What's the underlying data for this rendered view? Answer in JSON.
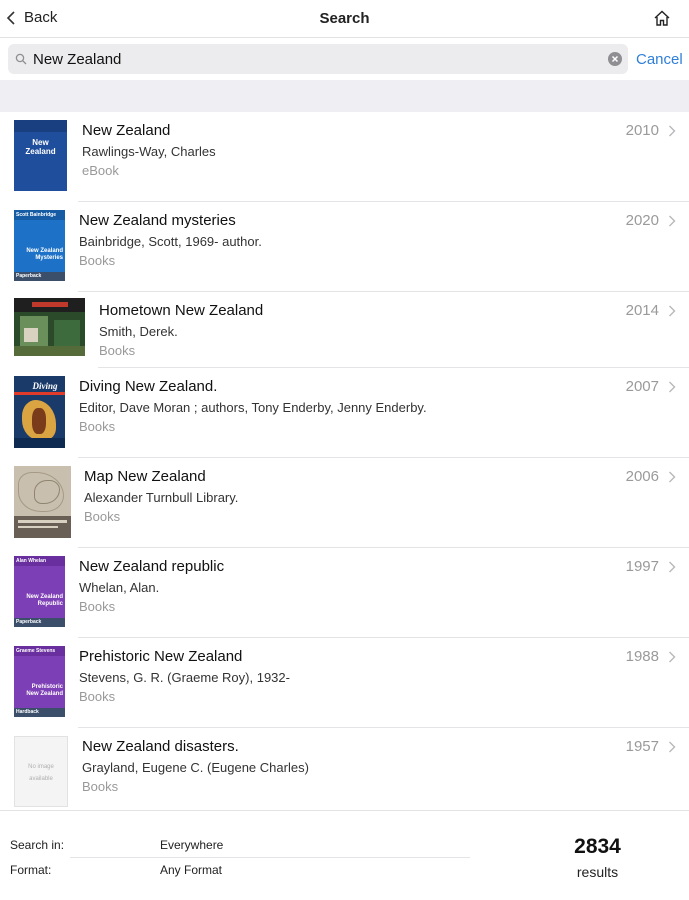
{
  "nav": {
    "back_label": "Back",
    "title": "Search"
  },
  "search": {
    "query": "New Zealand",
    "cancel_label": "Cancel"
  },
  "results": [
    {
      "title": "New Zealand",
      "author": "Rawlings-Way, Charles",
      "format": "eBook",
      "year": "2010",
      "cover_text": "New\nZealand",
      "cover_color": "#1f4e9c"
    },
    {
      "title": "New Zealand mysteries",
      "author": "Bainbridge, Scott, 1969- author.",
      "format": "Books",
      "year": "2020",
      "cover_top": "Scott Bainbridge",
      "cover_text": "New Zealand\nMysteries",
      "cover_bottom": "Paperback",
      "cover_color": "#1d72c8"
    },
    {
      "title": "Hometown New Zealand",
      "author": "Smith, Derek.",
      "format": "Books",
      "year": "2014",
      "cover_color": "#2a4a2a"
    },
    {
      "title": "Diving New Zealand.",
      "author": "Editor, Dave Moran ; authors, Tony Enderby, Jenny Enderby.",
      "format": "Books",
      "year": "2007",
      "cover_text": "Diving",
      "cover_color": "#1a3a6a"
    },
    {
      "title": "Map New Zealand",
      "author": "Alexander Turnbull Library.",
      "format": "Books",
      "year": "2006",
      "cover_color": "#c9bfae"
    },
    {
      "title": "New Zealand republic",
      "author": "Whelan, Alan.",
      "format": "Books",
      "year": "1997",
      "cover_top": "Alan Whelan",
      "cover_text": "New Zealand\nRepublic",
      "cover_bottom": "Paperback",
      "cover_color": "#7d3fb5"
    },
    {
      "title": "Prehistoric New Zealand",
      "author": "Stevens, G. R. (Graeme Roy), 1932-",
      "format": "Books",
      "year": "1988",
      "cover_top": "Graeme Stevens",
      "cover_text": "Prehistoric\nNew Zealand",
      "cover_bottom": "Hardback",
      "cover_color": "#7d3fb5"
    },
    {
      "title": "New Zealand disasters.",
      "author": "Grayland, Eugene C. (Eugene Charles)",
      "format": "Books",
      "year": "1957",
      "cover_text": "No image\navailable",
      "cover_color": "#f4f4f4"
    }
  ],
  "footer": {
    "search_in_label": "Search in:",
    "search_in_value": "Everywhere",
    "format_label": "Format:",
    "format_value": "Any Format",
    "result_count": "2834",
    "results_label": "results"
  },
  "colors": {
    "accent": "#2f7fd8",
    "muted": "#999999"
  },
  "icons": {
    "back": "chevron-left-icon",
    "home": "home-icon",
    "search": "search-icon",
    "clear": "clear-icon",
    "row_disclosure": "chevron-right-icon"
  }
}
